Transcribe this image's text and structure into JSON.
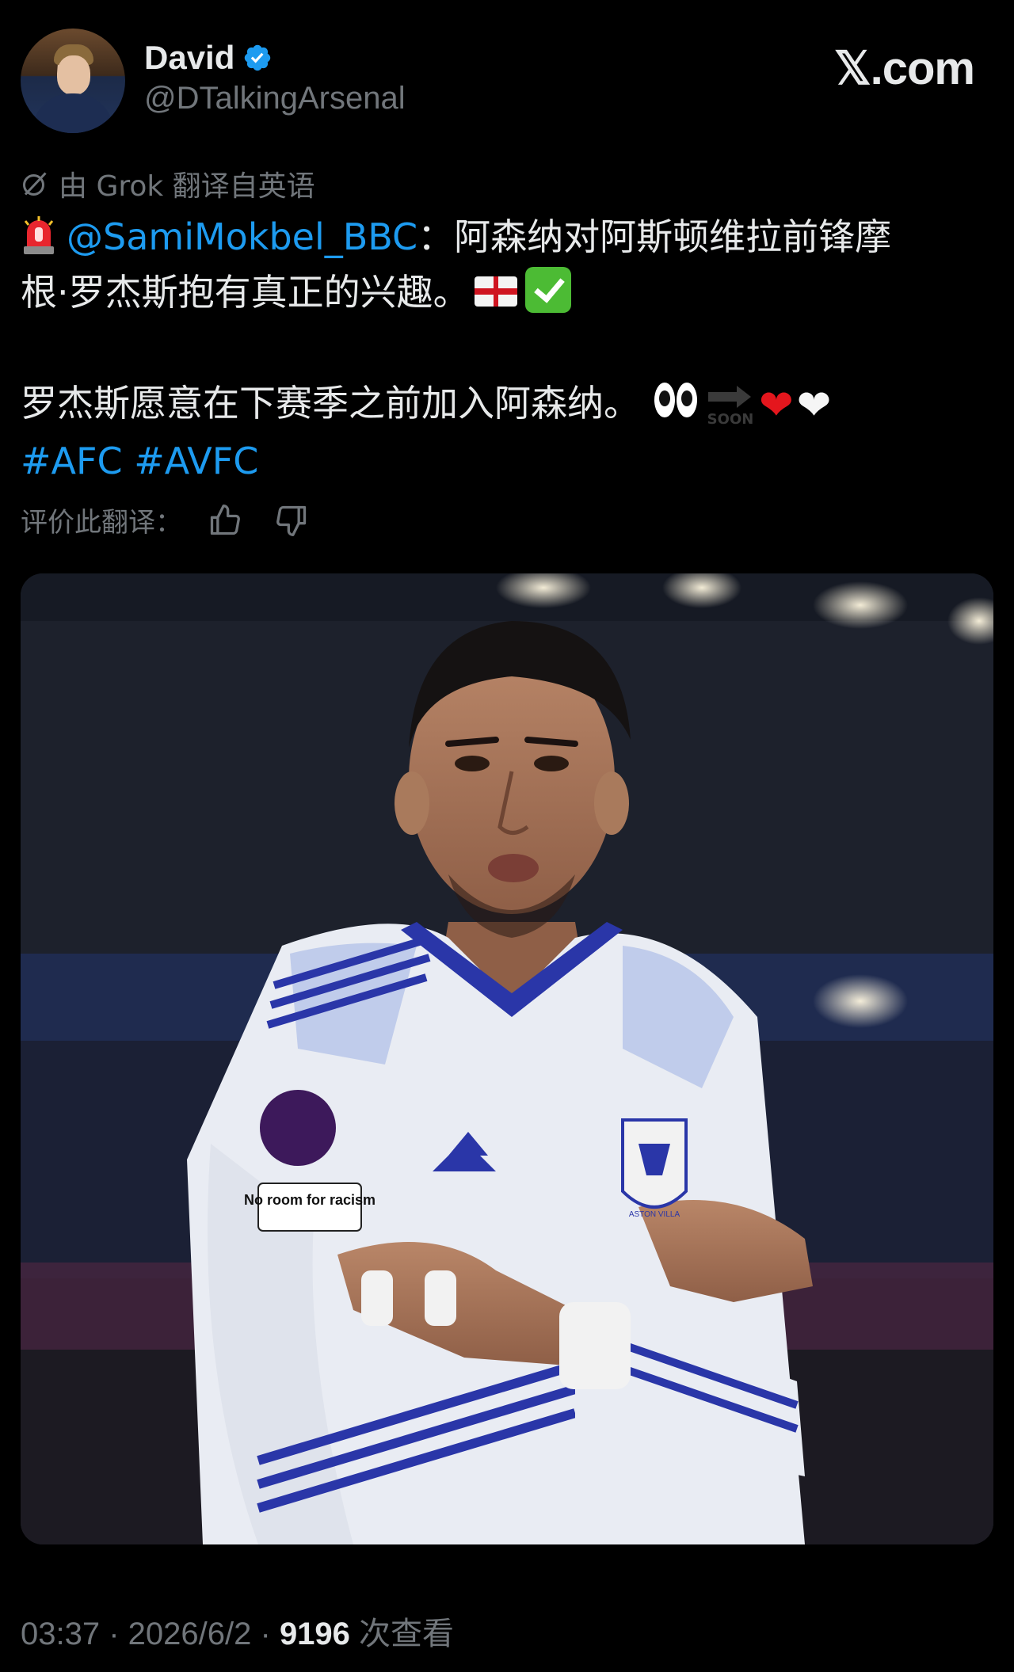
{
  "author": {
    "name": "David",
    "handle": "@DTalkingArsenal",
    "avatar_icon": "profile-photo",
    "verified_icon": "verified-badge-icon",
    "verified_color": "#1d9bf0"
  },
  "brand": {
    "label": "𝕏.com"
  },
  "translation": {
    "icon": "grok-icon",
    "note": "由 Grok 翻译自英语"
  },
  "tweet": {
    "mention": "@SamiMokbel_BBC",
    "line1_after_mention": "：阿森纳对阿斯顿维拉前锋摩",
    "line2": "根·罗杰斯抱有真正的兴趣。",
    "line3": "罗杰斯愿意在下赛季之前加入阿森纳。",
    "soon_label": "SOON",
    "hashtags": [
      "#AFC",
      "#AVFC"
    ],
    "emojis": [
      "siren",
      "england-flag",
      "check-mark",
      "eyes",
      "soon-arrow",
      "red-heart",
      "white-heart"
    ]
  },
  "rating": {
    "label": "评价此翻译：",
    "like_icon": "thumbs-up-icon",
    "dislike_icon": "thumbs-down-icon"
  },
  "media": {
    "type": "photo",
    "badges": [
      "No room for racism"
    ],
    "crest_text": "ASTON VILLA"
  },
  "meta": {
    "time": "03:37",
    "date": "2026/6/2",
    "views_count": "9196",
    "views_label": "次查看"
  },
  "colors": {
    "background": "#000000",
    "text": "#e7e9ea",
    "muted": "#71767b",
    "accent": "#1d9bf0"
  }
}
